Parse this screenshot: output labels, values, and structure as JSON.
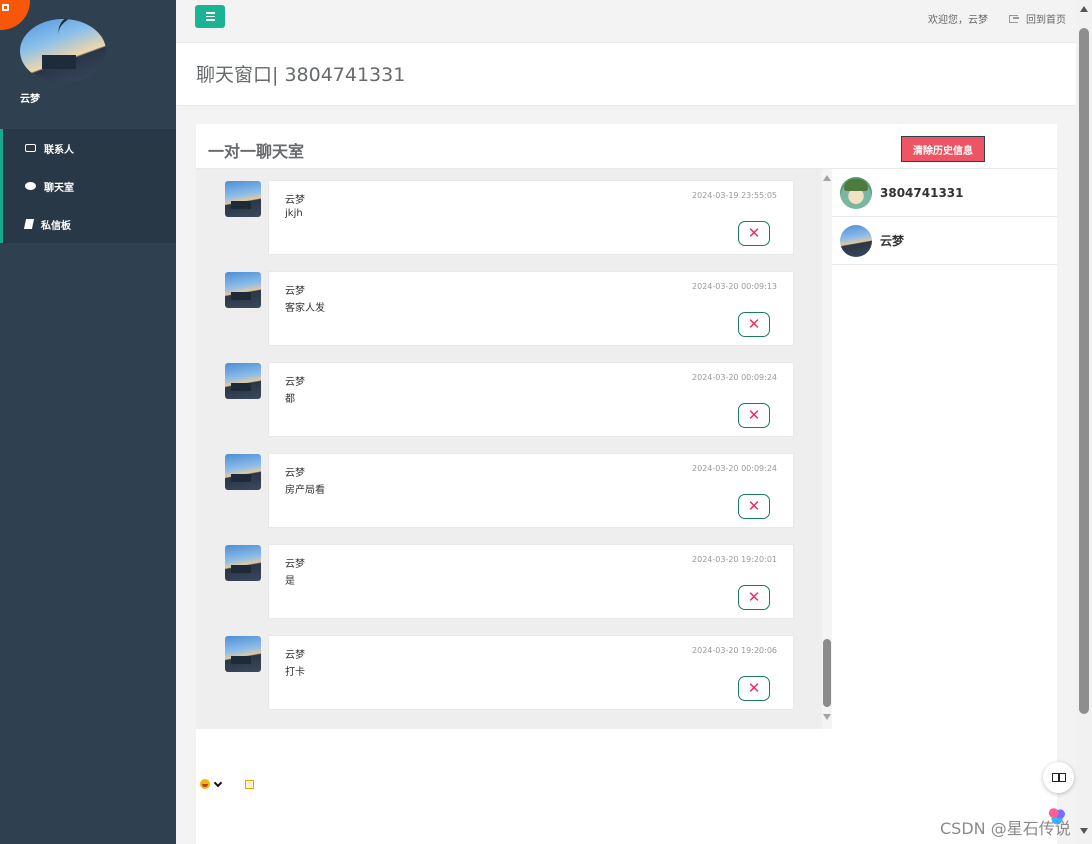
{
  "sidebar": {
    "profile_name": "云梦",
    "items": [
      {
        "label": "联系人",
        "icon": "contact-card-icon"
      },
      {
        "label": "聊天室",
        "icon": "chat-bubbles-icon"
      },
      {
        "label": "私信板",
        "icon": "book-icon"
      }
    ]
  },
  "topbar": {
    "welcome": "欢迎您，云梦",
    "logout_label": "回到首页"
  },
  "page": {
    "heading": "聊天窗口| 3804741331"
  },
  "chat": {
    "title": "一对一聊天室",
    "clear_label": "清除历史信息",
    "delete_symbol": "✕",
    "messages": [
      {
        "author": "云梦",
        "time": "2024-03-19 23:55:05",
        "text": "jkjh"
      },
      {
        "author": "云梦",
        "time": "2024-03-20 00:09:13",
        "text": "客家人发"
      },
      {
        "author": "云梦",
        "time": "2024-03-20 00:09:24",
        "text": "都"
      },
      {
        "author": "云梦",
        "time": "2024-03-20 00:09:24",
        "text": "房产局看"
      },
      {
        "author": "云梦",
        "time": "2024-03-20 19:20:01",
        "text": "是"
      },
      {
        "author": "云梦",
        "time": "2024-03-20 19:20:06",
        "text": "打卡"
      }
    ],
    "contacts": [
      {
        "name": "3804741331",
        "avatar": "cartoon-avatar"
      },
      {
        "name": "云梦",
        "avatar": "photo-avatar"
      }
    ]
  },
  "watermark": "CSDN @星石传说",
  "colors": {
    "sidebar": "#2f4050",
    "accent": "#1ab394",
    "danger": "#ed5565",
    "orange": "#f8570b"
  }
}
